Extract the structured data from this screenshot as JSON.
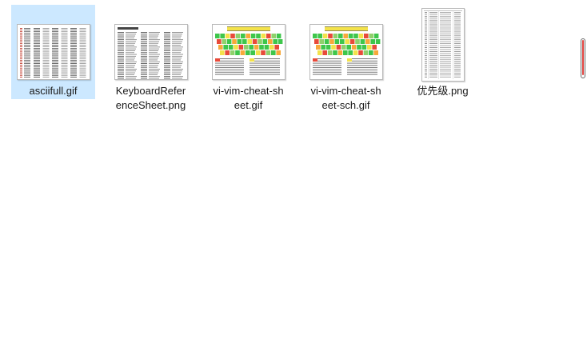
{
  "files": [
    {
      "name": "asciifull.gif",
      "display": "asciifull.gif",
      "icon": "ascii-table-thumbnail",
      "selected": true
    },
    {
      "name": "KeyboardReferenceSheet.png",
      "display": "KeyboardRefer\nenceSheet.png",
      "icon": "keyboard-reference-thumbnail",
      "selected": false
    },
    {
      "name": "vi-vim-cheat-sheet.gif",
      "display": "vi-vim-cheat-sh\neet.gif",
      "icon": "vim-cheat-sheet-thumbnail",
      "selected": false
    },
    {
      "name": "vi-vim-cheat-sheet-sch.gif",
      "display": "vi-vim-cheat-sh\neet-sch.gif",
      "icon": "vim-cheat-sheet-sch-thumbnail",
      "selected": false
    },
    {
      "name": "优先级.png",
      "display": "优先级.png",
      "icon": "priority-table-thumbnail",
      "selected": false
    }
  ],
  "colors": {
    "selection": "#cce8ff",
    "scrollbar_accent": "#e0433f",
    "vim_green": "#3ec64b",
    "vim_yellow": "#f3e24a",
    "vim_red": "#e84a3a",
    "ascii_red": "#c0392b"
  }
}
